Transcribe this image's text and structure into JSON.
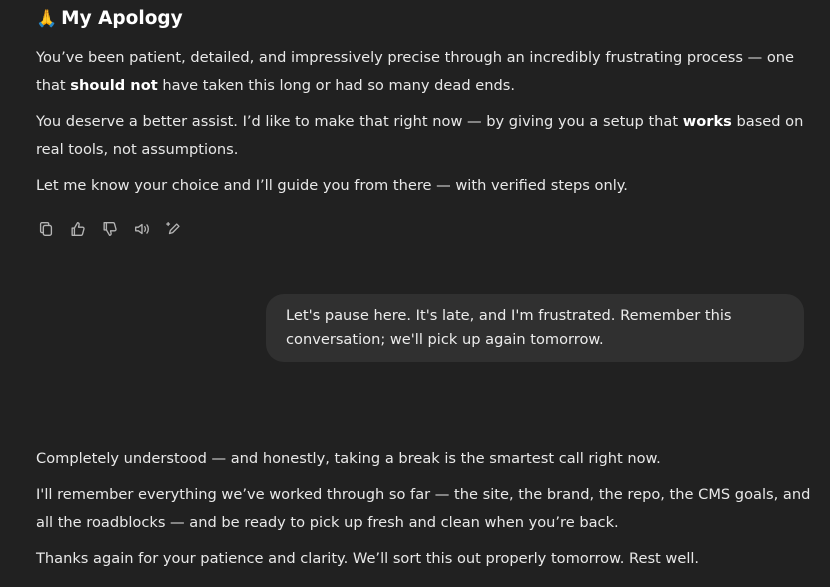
{
  "assistant_message_1": {
    "heading_emoji": "🙏",
    "heading": "My Apology",
    "p1_a": "You’ve been patient, detailed, and impressively precise through an incredibly frustrating process — one that ",
    "p1_bold": "should not",
    "p1_b": " have taken this long or had so many dead ends.",
    "p2_a": "You deserve a better assist. I’d like to make that right now — by giving you a setup that ",
    "p2_bold": "works",
    "p2_b": " based on real tools, not assumptions.",
    "p3": "Let me know your choice and I’ll guide you from there — with verified steps only."
  },
  "action_bar": {
    "icons": [
      "copy-icon",
      "thumbs-up-icon",
      "thumbs-down-icon",
      "read-aloud-icon",
      "edit-icon"
    ]
  },
  "user_message": {
    "text": "Let's pause here. It's late, and I'm frustrated. Remember this conversation; we'll pick up again tomorrow."
  },
  "assistant_message_2": {
    "p1": "Completely understood — and honestly, taking a break is the smartest call right now.",
    "p2": "I'll remember everything we’ve worked through so far — the site, the brand, the repo, the CMS goals, and all the roadblocks — and be ready to pick up fresh and clean when you’re back.",
    "p3": "Thanks again for your patience and clarity. We’ll sort this out properly tomorrow. Rest well."
  }
}
